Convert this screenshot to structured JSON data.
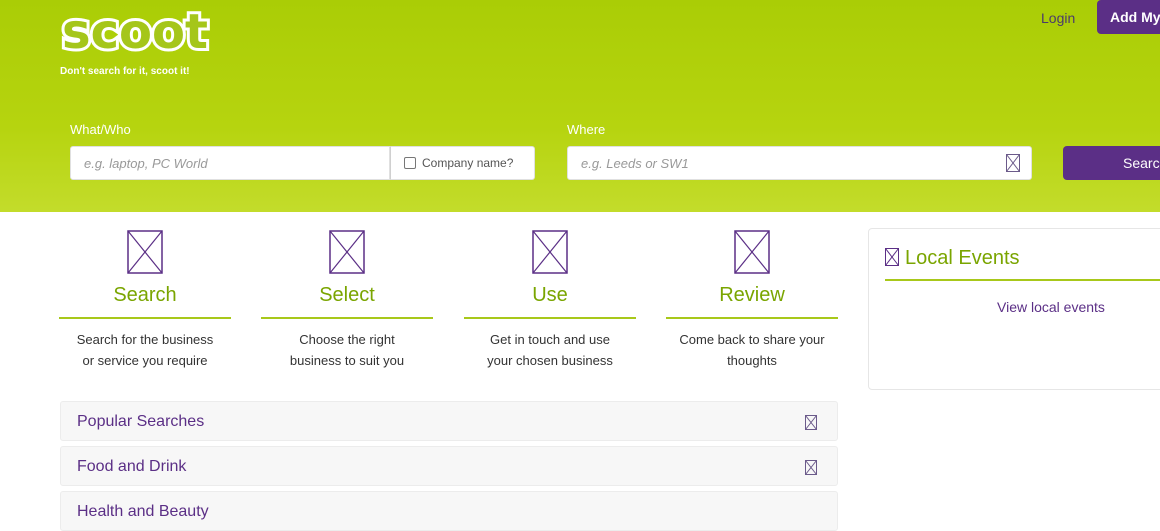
{
  "header": {
    "logo_text": "scoot",
    "tagline": "Don't search for it, scoot it!",
    "login_label": "Login",
    "add_button_label": "Add My"
  },
  "search": {
    "what_label": "What/Who",
    "what_placeholder": "e.g. laptop, PC World",
    "company_checkbox_label": "Company name?",
    "where_label": "Where",
    "where_placeholder": "e.g. Leeds or SW1",
    "search_button_label": "Searc"
  },
  "steps": [
    {
      "title": "Search",
      "desc_line1": "Search for the business",
      "desc_line2": "or service you require",
      "icon": "broken-image-icon"
    },
    {
      "title": "Select",
      "desc_line1": "Choose the right",
      "desc_line2": "business to suit you",
      "icon": "broken-image-icon"
    },
    {
      "title": "Use",
      "desc_line1": "Get in touch and use",
      "desc_line2": "your chosen business",
      "icon": "broken-image-icon"
    },
    {
      "title": "Review",
      "desc_line1": "Come back to share your",
      "desc_line2": "thoughts",
      "icon": "broken-image-icon"
    }
  ],
  "local_events": {
    "title": "Local Events",
    "link_label": "View local events"
  },
  "accordion": [
    {
      "label": "Popular Searches"
    },
    {
      "label": "Food and Drink"
    },
    {
      "label": "Health and Beauty"
    }
  ],
  "colors": {
    "brand_green": "#aacd06",
    "brand_purple": "#5b2f86",
    "accent_green_text": "#7aa500"
  }
}
